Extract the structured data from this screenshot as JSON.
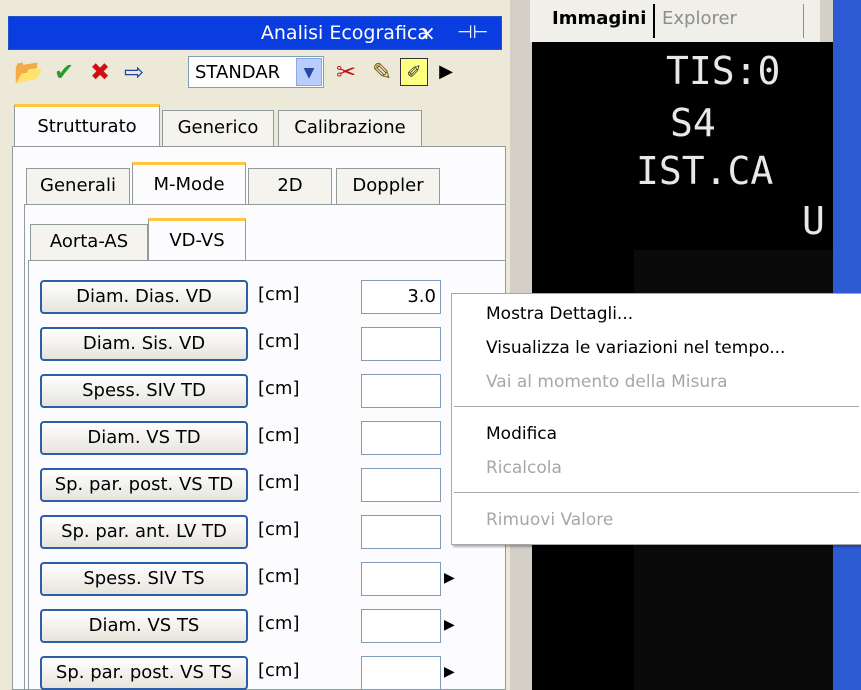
{
  "window": {
    "title": "Analisi Ecografica",
    "close": "×",
    "pin": "⊣⊢"
  },
  "toolbar": {
    "combo_value": "STANDAR"
  },
  "tabs_level1": [
    {
      "label": "Strutturato"
    },
    {
      "label": "Generico"
    },
    {
      "label": "Calibrazione"
    }
  ],
  "tabs_level2": [
    {
      "label": "Generali"
    },
    {
      "label": "M-Mode"
    },
    {
      "label": "2D"
    },
    {
      "label": "Doppler"
    }
  ],
  "tabs_level3": [
    {
      "label": "Aorta-AS"
    },
    {
      "label": "VD-VS"
    }
  ],
  "rows": [
    {
      "label": "Diam. Dias. VD",
      "unit": "[cm]",
      "value": "3.0"
    },
    {
      "label": "Diam. Sis. VD",
      "unit": "[cm]",
      "value": ""
    },
    {
      "label": "Spess. SIV TD",
      "unit": "[cm]",
      "value": ""
    },
    {
      "label": "Diam. VS TD",
      "unit": "[cm]",
      "value": ""
    },
    {
      "label": "Sp. par. post. VS TD",
      "unit": "[cm]",
      "value": ""
    },
    {
      "label": "Sp. par. ant. LV TD",
      "unit": "[cm]",
      "value": ""
    },
    {
      "label": "Spess. SIV TS",
      "unit": "[cm]",
      "value": ""
    },
    {
      "label": "Diam. VS TS",
      "unit": "[cm]",
      "value": ""
    },
    {
      "label": "Sp. par. post. VS TS",
      "unit": "[cm]",
      "value": ""
    }
  ],
  "right": {
    "tab_images": "Immagini",
    "tab_explorer": "Explorer",
    "overlay": [
      "TIS:0",
      "S4",
      "IST.CA",
      "U"
    ]
  },
  "context_menu": {
    "items": [
      {
        "label": "Mostra Dettagli...",
        "enabled": true
      },
      {
        "label": "Visualizza le variazioni nel tempo...",
        "enabled": true
      },
      {
        "label": "Vai al momento della Misura",
        "enabled": false
      },
      {
        "label": "Modifica",
        "enabled": true
      },
      {
        "label": "Ricalcola",
        "enabled": false
      },
      {
        "label": "Rimuovi Valore",
        "enabled": false
      }
    ]
  }
}
